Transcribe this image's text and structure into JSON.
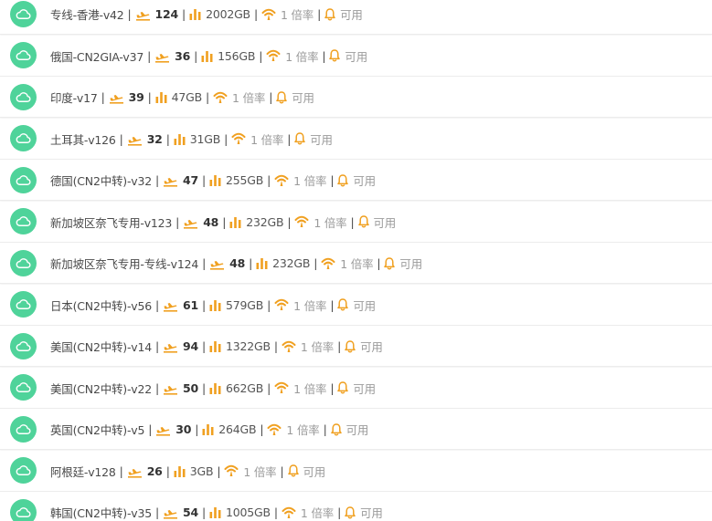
{
  "colors": {
    "status_green": "#4fd39a",
    "icon_orange": "#f0a020",
    "text": "#4a4a4a",
    "muted": "#9a9a9a"
  },
  "icons": {
    "status": "cloud-icon",
    "online": "plane-icon",
    "traffic": "bar-chart-icon",
    "rate": "signal-icon",
    "status_text": "bell-icon"
  },
  "nodes": [
    {
      "name": "专线-香港-v42",
      "online": "124",
      "traffic": "2002GB",
      "rate": "1 倍率",
      "status": "可用"
    },
    {
      "name": "俄国-CN2GIA-v37",
      "online": "36",
      "traffic": "156GB",
      "rate": "1 倍率",
      "status": "可用"
    },
    {
      "name": "印度-v17",
      "online": "39",
      "traffic": "47GB",
      "rate": "1 倍率",
      "status": "可用"
    },
    {
      "name": "土耳其-v126",
      "online": "32",
      "traffic": "31GB",
      "rate": "1 倍率",
      "status": "可用"
    },
    {
      "name": "德国(CN2中转)-v32",
      "online": "47",
      "traffic": "255GB",
      "rate": "1 倍率",
      "status": "可用"
    },
    {
      "name": "新加坡区奈飞专用-v123",
      "online": "48",
      "traffic": "232GB",
      "rate": "1 倍率",
      "status": "可用"
    },
    {
      "name": "新加坡区奈飞专用-专线-v124",
      "online": "48",
      "traffic": "232GB",
      "rate": "1 倍率",
      "status": "可用"
    },
    {
      "name": "日本(CN2中转)-v56",
      "online": "61",
      "traffic": "579GB",
      "rate": "1 倍率",
      "status": "可用"
    },
    {
      "name": "美国(CN2中转)-v14",
      "online": "94",
      "traffic": "1322GB",
      "rate": "1 倍率",
      "status": "可用"
    },
    {
      "name": "美国(CN2中转)-v22",
      "online": "50",
      "traffic": "662GB",
      "rate": "1 倍率",
      "status": "可用"
    },
    {
      "name": "英国(CN2中转)-v5",
      "online": "30",
      "traffic": "264GB",
      "rate": "1 倍率",
      "status": "可用"
    },
    {
      "name": "阿根廷-v128",
      "online": "26",
      "traffic": "3GB",
      "rate": "1 倍率",
      "status": "可用"
    },
    {
      "name": "韩国(CN2中转)-v35",
      "online": "54",
      "traffic": "1005GB",
      "rate": "1 倍率",
      "status": "可用"
    }
  ]
}
